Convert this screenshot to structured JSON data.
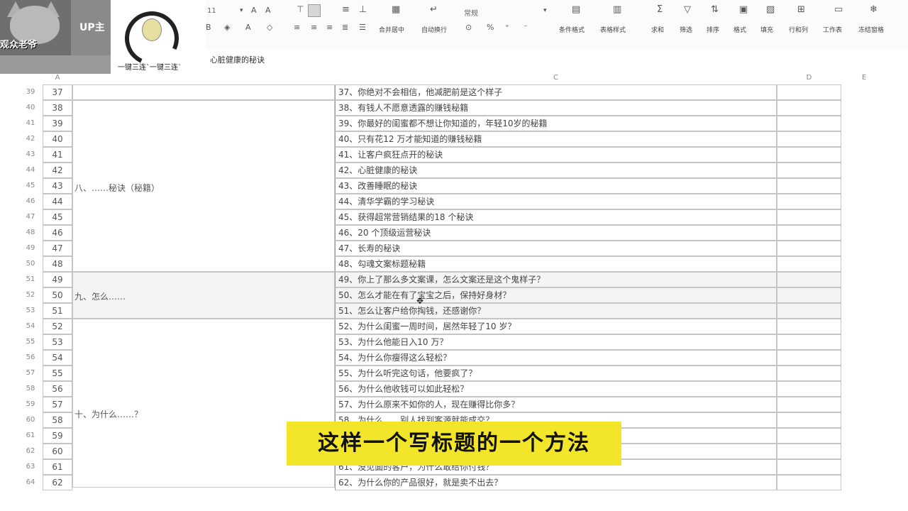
{
  "ribbon": {
    "font_size": "11",
    "number_format": "常规",
    "merge_center": "合并居中",
    "wrap_text": "自动换行",
    "conditional_format": "条件格式",
    "table_style": "表格样式",
    "sum": "求和",
    "filter": "筛选",
    "sort": "排序",
    "format": "格式",
    "fill": "填充",
    "rows_cols": "行和列",
    "worksheet": "工作表",
    "freeze": "冻结窗格"
  },
  "overlay": {
    "cat_text": "观众老爷",
    "up_label": "UP主",
    "meme_text": "一键三连`一键三连`"
  },
  "formula_bar": {
    "content": "心脏健康的秘诀"
  },
  "columns": [
    "A",
    "C",
    "D",
    "E"
  ],
  "rows": [
    {
      "row": "39",
      "a": "37",
      "c": "37、你绝对不会相信，他减肥前是这个样子"
    },
    {
      "row": "40",
      "a": "38",
      "c": "38、有钱人不愿意透露的赚钱秘籍"
    },
    {
      "row": "41",
      "a": "39",
      "c": "39、你最好的闺蜜都不想让你知道的，年轻10岁的秘籍"
    },
    {
      "row": "42",
      "a": "40",
      "c": "40、只有花12 万才能知道的赚钱秘籍"
    },
    {
      "row": "43",
      "a": "41",
      "c": "41、让客户疯狂点开的秘诀"
    },
    {
      "row": "44",
      "a": "42",
      "c": "42、心脏健康的秘诀"
    },
    {
      "row": "45",
      "a": "43",
      "c": "43、改善睡眠的秘诀"
    },
    {
      "row": "46",
      "a": "44",
      "c": "44、清华学霸的学习秘诀"
    },
    {
      "row": "47",
      "a": "45",
      "c": "45、获得超常营销结果的18 个秘诀"
    },
    {
      "row": "48",
      "a": "46",
      "c": "46、20 个顶级运营秘诀"
    },
    {
      "row": "49",
      "a": "47",
      "c": "47、长寿的秘诀"
    },
    {
      "row": "50",
      "a": "48",
      "c": "48、勾魂文案标题秘籍"
    },
    {
      "row": "51",
      "a": "49",
      "c": "49、你上了那么多文案课，怎么文案还是这个鬼样子？"
    },
    {
      "row": "52",
      "a": "50",
      "c": "50、怎么才能在有了宝宝之后，保持好身材？"
    },
    {
      "row": "53",
      "a": "51",
      "c": "51、怎么让客户给你掏钱，还感谢你？"
    },
    {
      "row": "54",
      "a": "52",
      "c": "52、为什么闺蜜一周时间，居然年轻了10 岁？"
    },
    {
      "row": "55",
      "a": "53",
      "c": "53、为什么他能日入10 万？"
    },
    {
      "row": "56",
      "a": "54",
      "c": "54、为什么你瘦得这么轻松？"
    },
    {
      "row": "57",
      "a": "55",
      "c": "55、为什么听完这句话，他要疯了？"
    },
    {
      "row": "58",
      "a": "56",
      "c": "56、为什么他收钱可以如此轻松？"
    },
    {
      "row": "59",
      "a": "57",
      "c": "57、为什么原来不如你的人，现在赚得比你多？"
    },
    {
      "row": "60",
      "a": "58",
      "c": "58、为什么……别人找到客源就能成交？"
    },
    {
      "row": "61",
      "a": "59",
      "c": ""
    },
    {
      "row": "62",
      "a": "60",
      "c": ""
    },
    {
      "row": "63",
      "a": "61",
      "c": "61、没见面的客户，为什么敢给你付钱？"
    },
    {
      "row": "64",
      "a": "62",
      "c": "62、为什么你的产品很好，就是卖不出去？"
    }
  ],
  "groups": [
    {
      "label": "八、……秘诀（秘籍）"
    },
    {
      "label": "九、怎么……"
    },
    {
      "label": "十、为什么……？"
    }
  ],
  "subtitle": "这样一个写标题的一个方法"
}
